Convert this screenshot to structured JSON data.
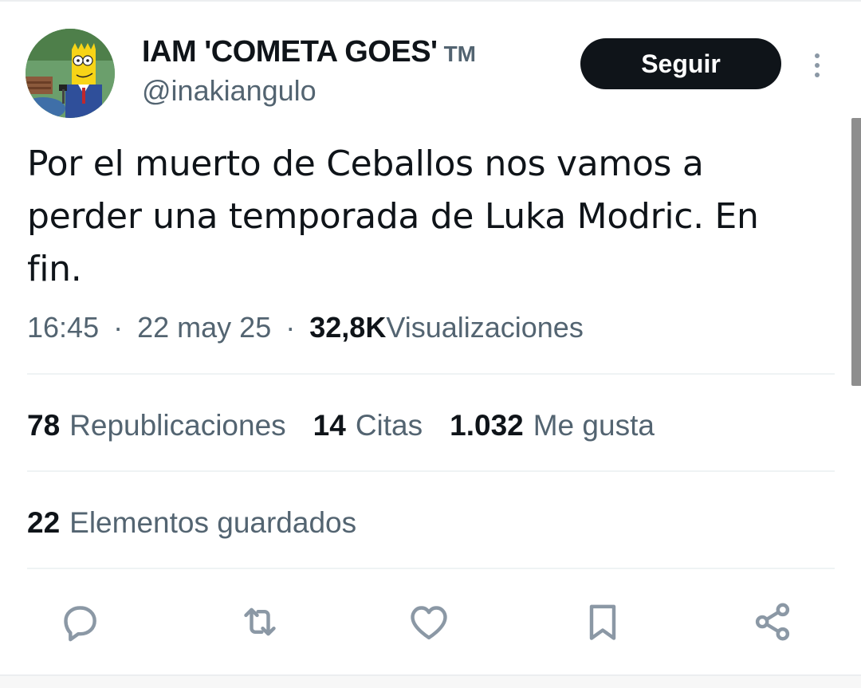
{
  "user": {
    "display_name": "IAM 'COMETA GOES'",
    "tm_mark": "TM",
    "handle": "@inakiangulo",
    "follow_label": "Seguir"
  },
  "tweet": {
    "text": "Por el muerto de Ceballos nos vamos a perder una temporada de Luka Modric. En fin.",
    "time": "16:45",
    "sep": "·",
    "date": "22 may 25",
    "views_count": "32,8K",
    "views_label": "Visualizaciones"
  },
  "stats": {
    "reposts_count": "78",
    "reposts_label": "Republicaciones",
    "quotes_count": "14",
    "quotes_label": "Citas",
    "likes_count": "1.032",
    "likes_label": "Me gusta",
    "bookmarks_count": "22",
    "bookmarks_label": "Elementos guardados"
  },
  "actions": [
    "reply-icon",
    "repost-icon",
    "like-icon",
    "bookmark-icon",
    "share-icon"
  ],
  "colors": {
    "text_primary": "#0f1419",
    "text_secondary": "#536471",
    "icon": "#8b98a5",
    "button_bg": "#0f1419",
    "divider": "#eff3f4"
  }
}
